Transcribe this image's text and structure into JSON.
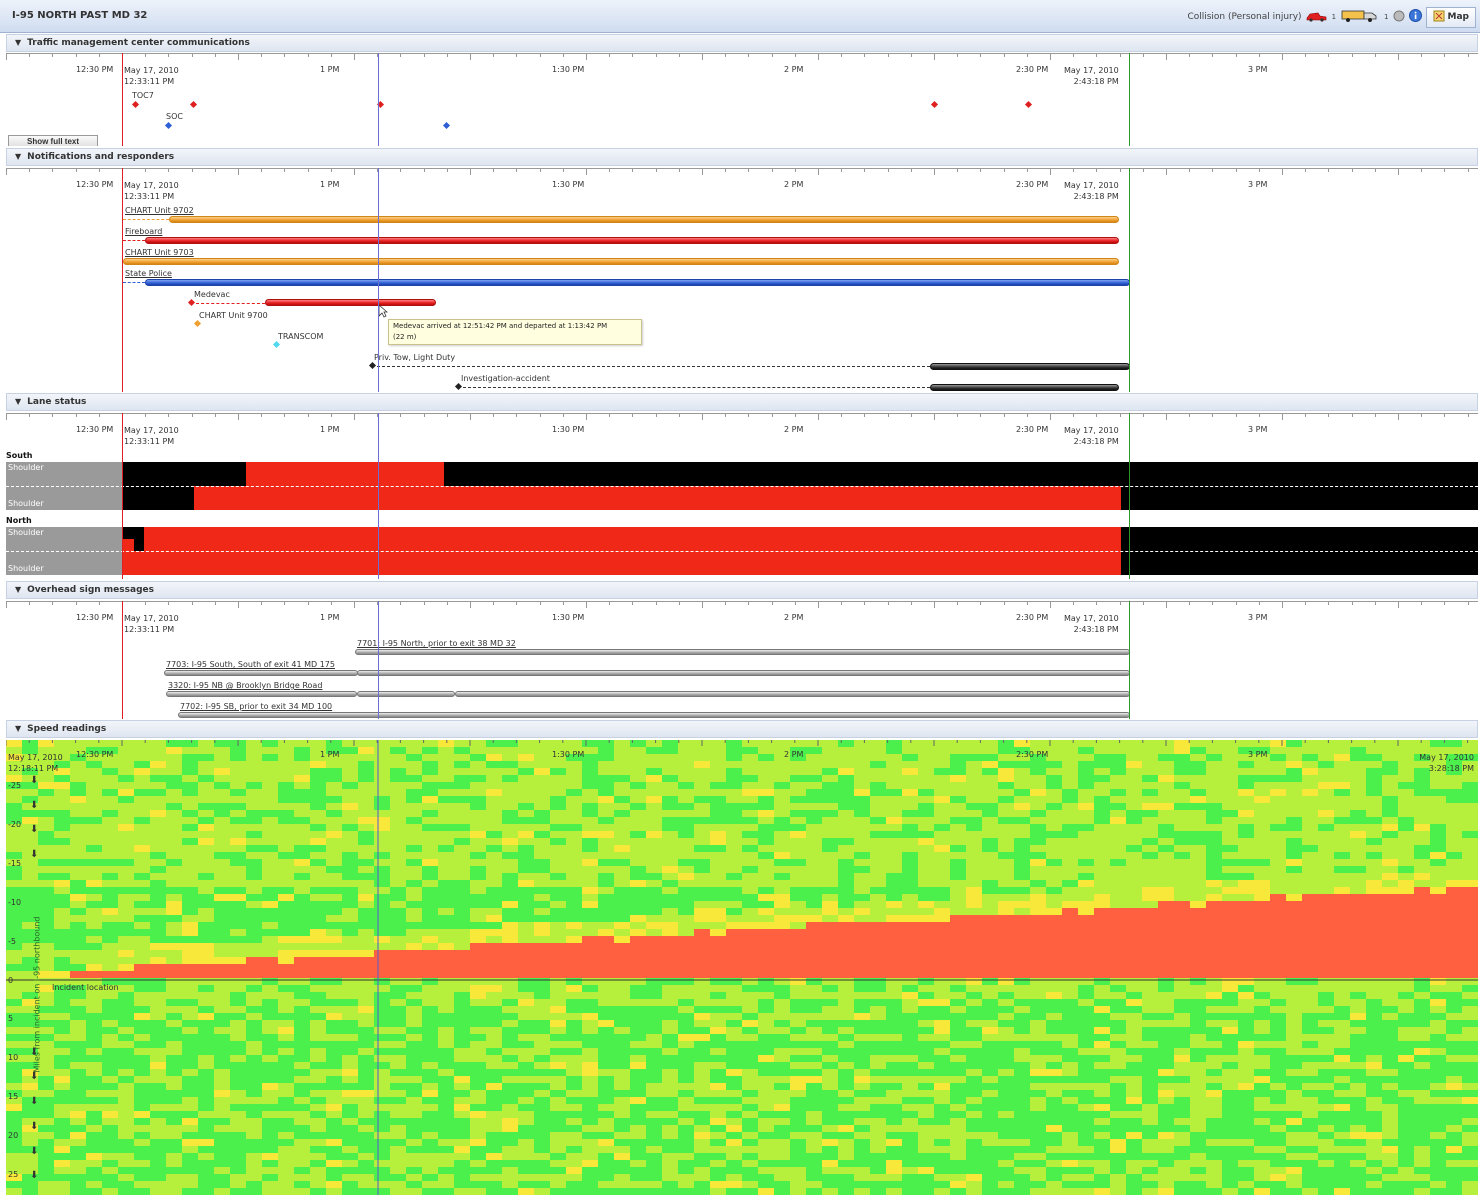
{
  "titlebar": {
    "title": "I-95 NORTH PAST MD 32",
    "incident_type": "Collision (Personal injury)",
    "vehicle_count_1": "1",
    "vehicle_count_2": "1",
    "map_label": "Map"
  },
  "time_axis": {
    "ticks": [
      "12:30 PM",
      "1 PM",
      "1:30 PM",
      "2 PM",
      "2:30 PM",
      "3 PM"
    ],
    "start_date": "May 17, 2010",
    "start_time": "12:33:11 PM",
    "end_date": "May 17, 2010",
    "end_time": "2:43:18 PM"
  },
  "sections": {
    "tmc": {
      "title": "Traffic management center communications",
      "show_full_text": "Show full text",
      "channels": [
        "TOC7",
        "SOC"
      ]
    },
    "notifications": {
      "title": "Notifications and responders",
      "responders": [
        "CHART Unit 9702",
        "Fireboard",
        "CHART Unit 9703",
        "State Police",
        "Medevac",
        "CHART Unit 9700",
        "TRANSCOM",
        "Priv. Tow, Light Duty",
        "Investigation-accident"
      ],
      "tooltip_line1": "Medevac arrived at 12:51:42 PM and departed at 1:13:42 PM",
      "tooltip_line2": "(22 m)"
    },
    "lane": {
      "title": "Lane status",
      "south": "South",
      "north": "North",
      "shoulder": "Shoulder"
    },
    "signs": {
      "title": "Overhead sign messages",
      "messages": [
        "7701: I-95 North, prior to exit 38 MD 32",
        "7703: I-95 South, South of exit 41 MD 175",
        "3320: I-95 NB @ Brooklyn Bridge Road",
        "7702: I-95 SB, prior to exit 34 MD 100"
      ]
    },
    "speed": {
      "title": "Speed readings",
      "start_date": "May 17, 2010",
      "start_time": "12:18:11 PM",
      "end_date": "May 17, 2010",
      "end_time": "3:28:18 PM",
      "axis_label": "Miles from incident on I-95 northbound",
      "incident_label": "Incident location",
      "y_ticks": [
        "-25",
        "-20",
        "-15",
        "-10",
        "-5",
        "0",
        "5",
        "10",
        "15",
        "20",
        "25"
      ]
    }
  },
  "colors": {
    "incident_line": "#e02020",
    "cursor_line": "#6d6dd8",
    "clear_line": "#2a9a2a",
    "lane_closed": "#f02818",
    "lane_open": "#000000",
    "speed_fast": "#4cf04c",
    "speed_mid": "#b6ef3c",
    "speed_slow": "#f8e83a",
    "speed_jam": "#ff6040"
  }
}
